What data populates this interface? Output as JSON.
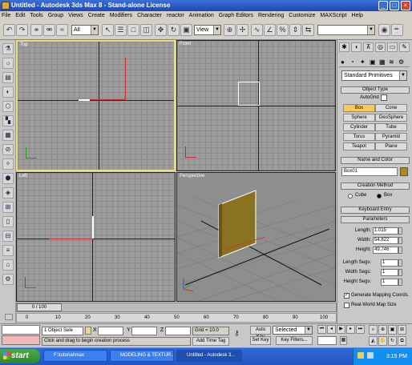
{
  "window": {
    "title": "Untitled - Autodesk 3ds Max 8 - Stand-alone License"
  },
  "menu": [
    "File",
    "Edit",
    "Tools",
    "Group",
    "Views",
    "Create",
    "Modifiers",
    "Character",
    "reactor",
    "Animation",
    "Graph Editors",
    "Rendering",
    "Customize",
    "MAXScript",
    "Help"
  ],
  "toolbar": {
    "selection_filter": "All",
    "ref_coord": "View"
  },
  "viewports": {
    "top": "Top",
    "front": "Front",
    "left": "Left",
    "perspective": "Perspective"
  },
  "command_panel": {
    "category": "Standard Primitives",
    "object_type": "Object Type",
    "autogrid": "AutoGrid",
    "buttons": [
      "Box",
      "Cone",
      "Sphere",
      "GeoSphere",
      "Cylinder",
      "Tube",
      "Torus",
      "Pyramid",
      "Teapot",
      "Plane"
    ],
    "name_color": "Name and Color",
    "name_value": "Box01",
    "creation_method": "Creation Method",
    "cube": "Cube",
    "box": "Box",
    "keyboard_entry": "Keyboard Entry",
    "parameters": "Parameters",
    "length_label": "Length:",
    "length_value": "1.015",
    "width_label": "Width:",
    "width_value": "54.822",
    "height_label": "Height:",
    "height_value": "49.746",
    "lsegs_label": "Length Segs:",
    "lsegs_value": "1",
    "wsegs_label": "Width Segs:",
    "wsegs_value": "1",
    "hsegs_label": "Height Segs:",
    "hsegs_value": "1",
    "gen_mapping": "Generate Mapping Coords.",
    "real_world": "Real-World Map Size",
    "accent": "#f5cc5c"
  },
  "timeline": {
    "slider": "0 / 100",
    "ticks": [
      "0",
      "10",
      "20",
      "30",
      "40",
      "50",
      "60",
      "70",
      "80",
      "90",
      "100"
    ]
  },
  "status": {
    "selected": "1 Object Sele",
    "x_label": "X",
    "y_label": "Y",
    "z_label": "Z",
    "grid": "Grid = 10.0",
    "prompt": "Click and drag to begin creation process",
    "add_time_tag": "Add Time Tag",
    "auto_key": "Auto Key",
    "set_key": "Set Key",
    "selected_combo": "Selected",
    "key_filters": "Key Filters..."
  },
  "taskbar": {
    "start": "start",
    "tasks": [
      "F:\\tutorial\\max",
      "MODELING & TEXTUR...",
      "Untitled - Autodesk 3..."
    ],
    "clock": "3:15 PM"
  }
}
